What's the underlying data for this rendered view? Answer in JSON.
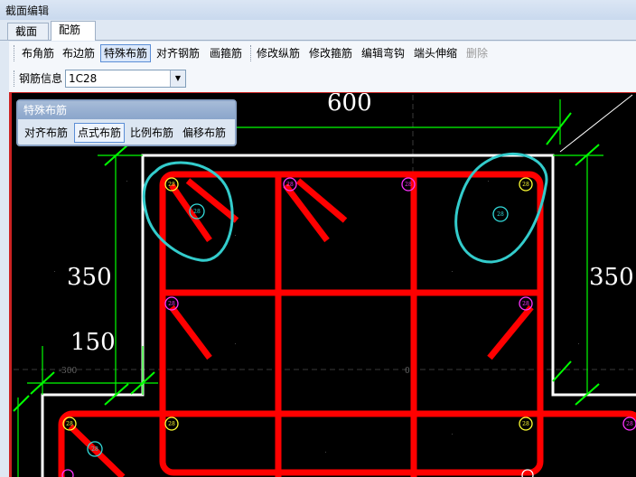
{
  "window": {
    "title": "截面编辑"
  },
  "tabs": [
    {
      "label": "截面"
    },
    {
      "label": "配筋"
    }
  ],
  "toolbar": {
    "items": [
      {
        "label": "布角筋"
      },
      {
        "label": "布边筋"
      },
      {
        "label": "特殊布筋"
      },
      {
        "label": "对齐钢筋"
      },
      {
        "label": "画箍筋"
      },
      {
        "label": "修改纵筋"
      },
      {
        "label": "修改箍筋"
      },
      {
        "label": "编辑弯钩"
      },
      {
        "label": "端头伸缩"
      },
      {
        "label": "删除"
      }
    ]
  },
  "rebar_info": {
    "label": "钢筋信息",
    "value": "1C28"
  },
  "special_panel": {
    "title": "特殊布筋",
    "buttons": [
      {
        "label": "对齐布筋"
      },
      {
        "label": "点式布筋"
      },
      {
        "label": "比例布筋"
      },
      {
        "label": "偏移布筋"
      }
    ]
  },
  "drawing": {
    "dimensions": {
      "top_width": "600",
      "left_height": "350",
      "right_height": "350",
      "left_offset": "150"
    },
    "bar_labels": {
      "bar_size": "28"
    },
    "axis_marks": {
      "center_mark": "0",
      "left_mark": "-300"
    },
    "colors": {
      "rebar": "#ff0000",
      "outline": "#ffffff",
      "dimension": "#00ff00",
      "highlight": "#33cccc",
      "marker_yellow": "#ffff33",
      "marker_magenta": "#ff33ff",
      "marker_cyan": "#33dddd"
    }
  }
}
